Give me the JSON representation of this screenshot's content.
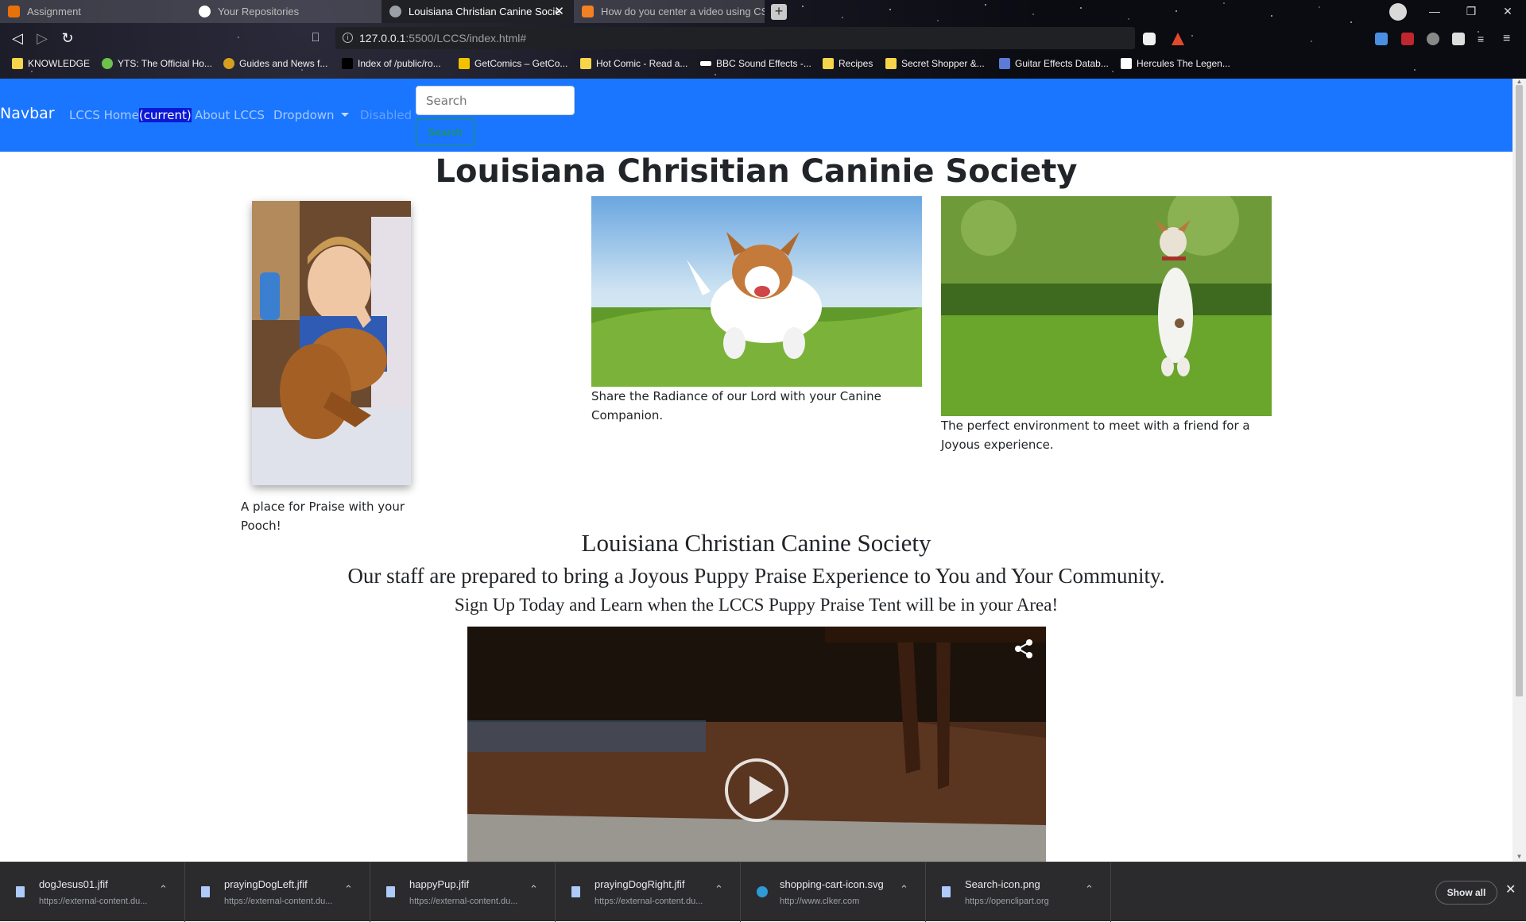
{
  "browser": {
    "tabs": [
      {
        "title": "Assignment",
        "state": "faded",
        "favicon_color": "#e8710a"
      },
      {
        "title": "Your Repositories",
        "state": "faded",
        "favicon_color": "#ffffff"
      },
      {
        "title": "Louisiana Christian Canine Socie",
        "state": "active",
        "favicon_color": "#9aa0a6"
      },
      {
        "title": "How do you center a video using CS",
        "state": "faded",
        "favicon_color": "#f48024"
      }
    ],
    "url_host": "127.0.0.1",
    "url_path": ":5500/LCCS/index.html#",
    "bookmarks": [
      {
        "label": "KNOWLEDGE",
        "icon_color": "#f7d54a"
      },
      {
        "label": "YTS: The Official Ho...",
        "icon_color": "#6dc24b"
      },
      {
        "label": "Guides and News f...",
        "icon_color": "#d4a020"
      },
      {
        "label": "Index of /public/ro...",
        "icon_color": "#000000"
      },
      {
        "label": "GetComics – GetCo...",
        "icon_color": "#f2c200"
      },
      {
        "label": "Hot Comic - Read a...",
        "icon_color": "#f7d54a"
      },
      {
        "label": "BBC Sound Effects -...",
        "icon_color": "#ffffff"
      },
      {
        "label": "Recipes",
        "icon_color": "#f7d54a"
      },
      {
        "label": "Secret Shopper &...",
        "icon_color": "#f7d54a"
      },
      {
        "label": "Guitar Effects Datab...",
        "icon_color": "#5b7bd5"
      },
      {
        "label": "Hercules The Legen...",
        "icon_color": "#ffffff"
      }
    ]
  },
  "navbar": {
    "brand": "Navbar",
    "home_label": "LCCS Home",
    "home_current": "(current)",
    "about_label": "About LCCS",
    "dropdown_label": "Dropdown",
    "disabled_label": "Disabled",
    "search_placeholder": "Search",
    "search_button": "Search"
  },
  "content": {
    "title": "Louisiana Chrisitian Caninie Society",
    "caption_left": "A place for Praise with your Pooch!",
    "caption_middle": "Share the Radiance of our Lord with your Canine Companion.",
    "caption_right": "The perfect environment to meet with a friend for a Joyous experience.",
    "heading_1": "Louisiana Christian Canine Society",
    "heading_2": "Our staff are prepared to bring a Joyous Puppy Praise Experience to You and Your Community.",
    "heading_3": "Sign Up Today and Learn when the LCCS Puppy Praise Tent will be in your Area!"
  },
  "downloads": {
    "items": [
      {
        "name": "dogJesus01.jfif",
        "url": "https://external-content.du..."
      },
      {
        "name": "prayingDogLeft.jfif",
        "url": "https://external-content.du..."
      },
      {
        "name": "happyPup.jfif",
        "url": "https://external-content.du..."
      },
      {
        "name": "prayingDogRight.jfif",
        "url": "https://external-content.du..."
      },
      {
        "name": "shopping-cart-icon.svg",
        "url": "http://www.clker.com"
      },
      {
        "name": "Search-icon.png",
        "url": "https://openclipart.org"
      }
    ],
    "show_all": "Show all"
  }
}
